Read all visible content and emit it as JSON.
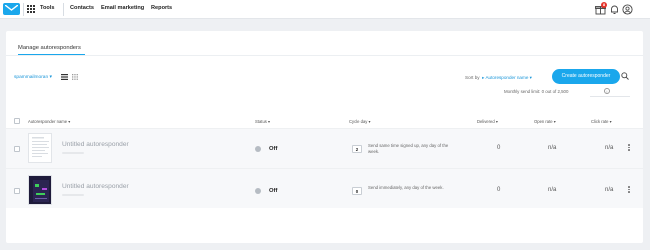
{
  "header": {
    "tools_label": "Tools",
    "nav": [
      "Contacts",
      "Email marketing",
      "Reports"
    ],
    "notification_count": "8"
  },
  "page": {
    "tab_label": "Manage autoresponders",
    "sender": "spammailmoran",
    "sort_by_label": "Sort by",
    "sort_by_value": "Autoresponder name",
    "create_button": "Create autoresponder",
    "monthly_limit": "Monthly send limit: 0 out of 2,500"
  },
  "table": {
    "columns": [
      "Autoresponder name",
      "Status",
      "Cycle day",
      "Delivered",
      "Open rate",
      "Click rate"
    ],
    "rows": [
      {
        "name": "Untitled autoresponder",
        "status": "Off",
        "cycle_day": "2",
        "cycle_desc": "Send same time signed up, any day of the week.",
        "delivered": "0",
        "open_rate": "n/a",
        "click_rate": "n/a"
      },
      {
        "name": "Untitled autoresponder",
        "status": "Off",
        "cycle_day": "0",
        "cycle_desc": "Send immediately, any day of the week.",
        "delivered": "0",
        "open_rate": "n/a",
        "click_rate": "n/a"
      }
    ]
  },
  "colors": {
    "accent": "#1aa7ec",
    "page_bg": "#eef0f3",
    "badge": "#e5332a"
  }
}
